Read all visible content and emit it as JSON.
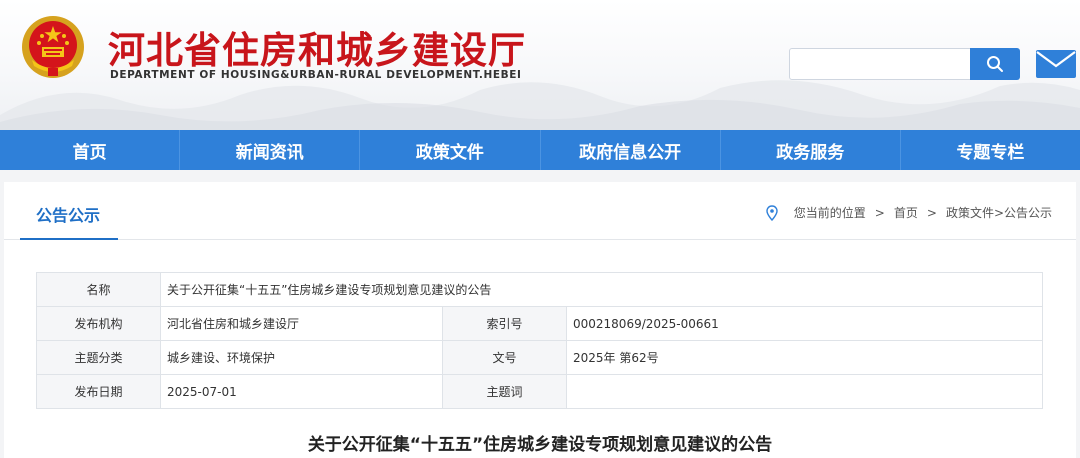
{
  "header": {
    "title": "河北省住房和城乡建设厅",
    "subtitle": "DEPARTMENT OF HOUSING&URBAN-RURAL DEVELOPMENT.HEBEI",
    "emblem_icon": "national-emblem-icon",
    "search_placeholder": "",
    "search_icon": "search-icon",
    "mail_icon": "mail-icon",
    "brand_color": "#c8151b",
    "accent_color": "#2f80d9"
  },
  "nav": {
    "items": [
      "首页",
      "新闻资讯",
      "政策文件",
      "政府信息公开",
      "政务服务",
      "专题专栏"
    ]
  },
  "section": {
    "title": "公告公示",
    "breadcrumb": {
      "label": "您当前的位置",
      "sep": ">",
      "home": "首页",
      "current": "政策文件>公告公示",
      "icon": "location-pin-icon"
    }
  },
  "meta": {
    "name_label": "名称",
    "name_value": "关于公开征集“十五五”住房城乡建设专项规划意见建议的公告",
    "issuer_label": "发布机构",
    "issuer_value": "河北省住房和城乡建设厅",
    "index_label": "索引号",
    "index_value": "000218069/2025-00661",
    "category_label": "主题分类",
    "category_value": "城乡建设、环境保护",
    "doc_no_label": "文号",
    "doc_no_value": "2025年 第62号",
    "date_label": "发布日期",
    "date_value": "2025-07-01",
    "keywords_label": "主题词",
    "keywords_value": ""
  },
  "article": {
    "title": "关于公开征集“十五五”住房城乡建设专项规划意见建议的公告"
  }
}
